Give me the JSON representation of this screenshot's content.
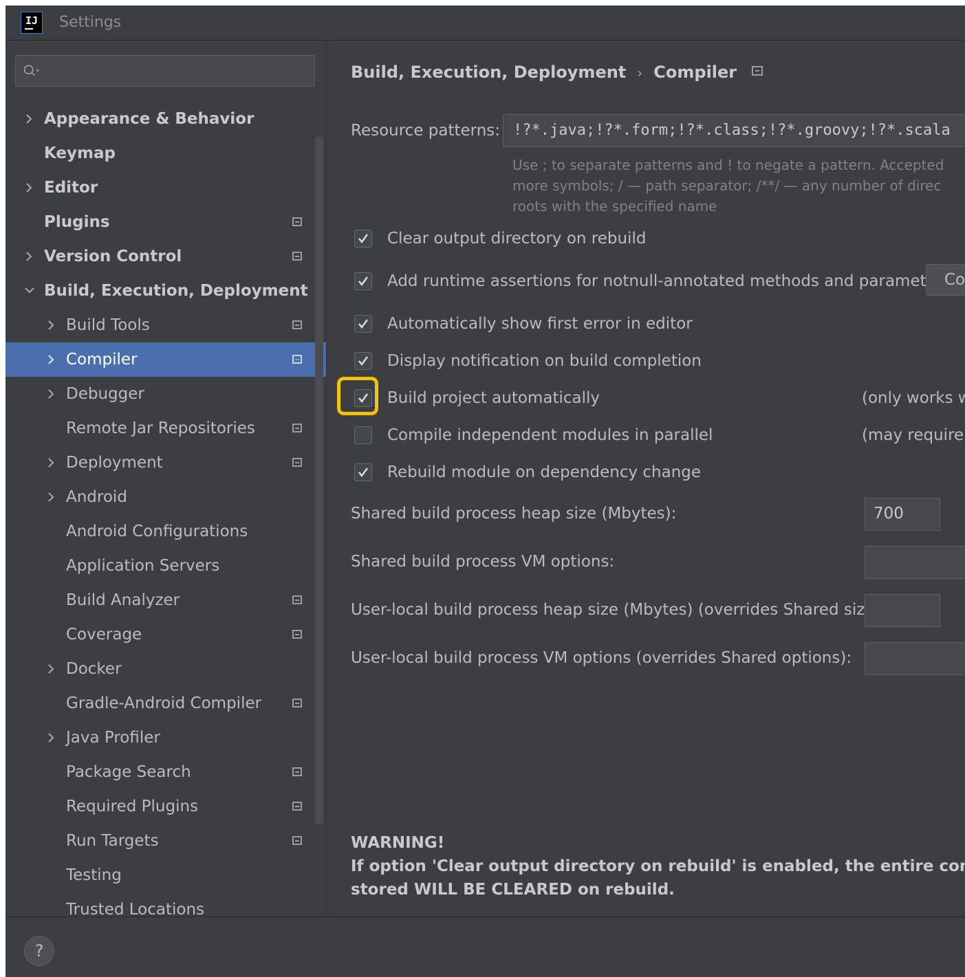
{
  "window": {
    "title": "Settings",
    "logo_text": "IJ"
  },
  "search": {
    "value": "",
    "icon": "search-icon"
  },
  "tree": {
    "appearance": "Appearance & Behavior",
    "keymap": "Keymap",
    "editor": "Editor",
    "plugins": "Plugins",
    "version_control": "Version Control",
    "build_execution_deployment": "Build, Execution, Deployment",
    "build_tools": "Build Tools",
    "compiler": "Compiler",
    "debugger": "Debugger",
    "remote_jar": "Remote Jar Repositories",
    "deployment": "Deployment",
    "android": "Android",
    "android_configurations": "Android Configurations",
    "application_servers": "Application Servers",
    "build_analyzer": "Build Analyzer",
    "coverage": "Coverage",
    "docker": "Docker",
    "gradle_android_compiler": "Gradle-Android Compiler",
    "java_profiler": "Java Profiler",
    "package_search": "Package Search",
    "required_plugins": "Required Plugins",
    "run_targets": "Run Targets",
    "testing": "Testing",
    "trusted_locations": "Trusted Locations"
  },
  "breadcrumb": {
    "parent": "Build, Execution, Deployment",
    "separator": "›",
    "current": "Compiler"
  },
  "compiler": {
    "resource_patterns_label": "Resource patterns:",
    "resource_patterns_value": "!?*.java;!?*.form;!?*.class;!?*.groovy;!?*.scala",
    "hint_line1": "Use ; to separate patterns and ! to negate a pattern. Accepted",
    "hint_line2": "more symbols; / — path separator; /**/ — any number of direc",
    "hint_line3": "roots with the specified name",
    "options": {
      "clear_output": {
        "label": "Clear output directory on rebuild",
        "checked": true
      },
      "runtime_assertions": {
        "label": "Add runtime assertions for notnull-annotated methods and parameters",
        "checked": true
      },
      "show_first_error": {
        "label": "Automatically show first error in editor",
        "checked": true
      },
      "display_notification": {
        "label": "Display notification on build completion",
        "checked": true
      },
      "build_automatically": {
        "label": "Build project automatically",
        "checked": true
      },
      "compile_parallel": {
        "label": "Compile independent modules in parallel",
        "checked": false
      },
      "rebuild_on_dependency": {
        "label": "Rebuild module on dependency change",
        "checked": true
      }
    },
    "configure_button": "Co",
    "build_auto_note": "(only works w",
    "parallel_note": "(may require l",
    "heap_size_label": "Shared build process heap size (Mbytes):",
    "heap_size_value": "700",
    "vm_options_label": "Shared build process VM options:",
    "vm_options_value": "",
    "user_heap_label": "User-local build process heap size (Mbytes) (overrides Shared size):",
    "user_heap_value": "",
    "user_vm_label": "User-local build process VM options (overrides Shared options):",
    "user_vm_value": "",
    "warning_title": "WARNING!",
    "warning_line1": "If option 'Clear output directory on rebuild' is enabled, the entire contents of",
    "warning_line2": "stored WILL BE CLEARED on rebuild."
  },
  "help": {
    "label": "?"
  },
  "colors": {
    "background": "#3c3f41",
    "selection": "#4b6eaf",
    "highlight": "#f5c400"
  }
}
